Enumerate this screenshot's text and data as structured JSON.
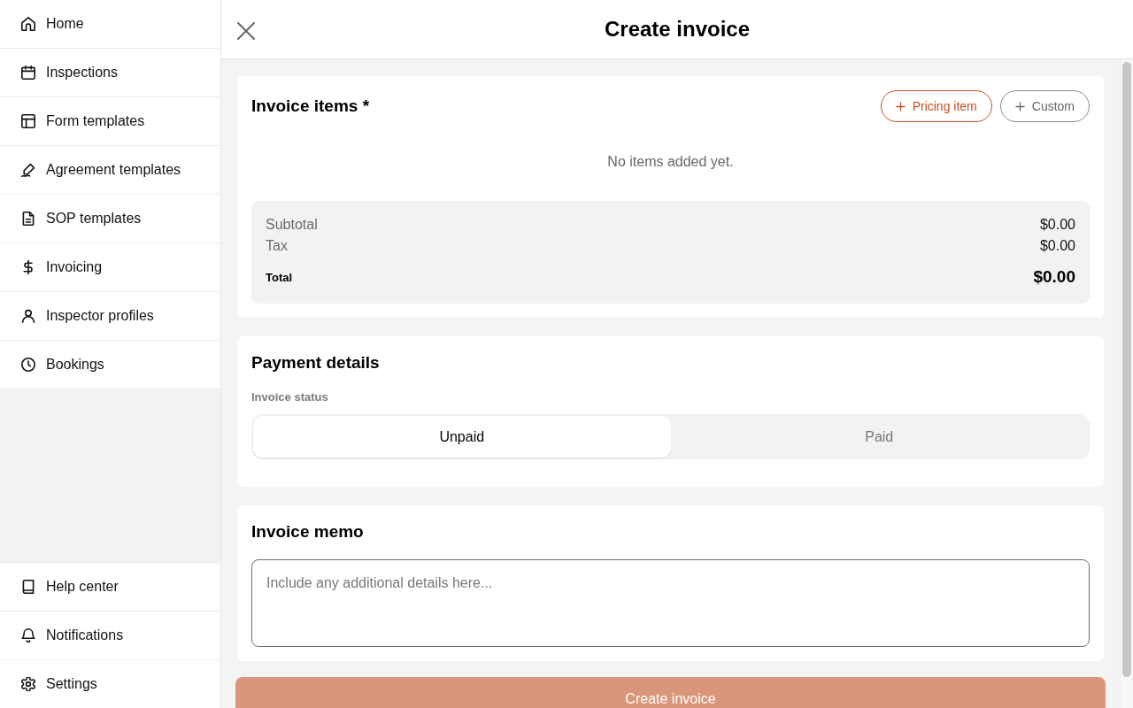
{
  "sidebar": {
    "items": [
      {
        "label": "Home"
      },
      {
        "label": "Inspections"
      },
      {
        "label": "Form templates"
      },
      {
        "label": "Agreement templates"
      },
      {
        "label": "SOP templates"
      },
      {
        "label": "Invoicing"
      },
      {
        "label": "Inspector profiles"
      },
      {
        "label": "Bookings"
      }
    ],
    "bottom_items": [
      {
        "label": "Help center"
      },
      {
        "label": "Notifications"
      },
      {
        "label": "Settings"
      }
    ]
  },
  "header": {
    "title": "Create invoice"
  },
  "invoice_items": {
    "title": "Invoice items *",
    "buttons": [
      {
        "label": "Pricing item",
        "kind": "primary"
      },
      {
        "label": "Custom",
        "kind": "secondary"
      }
    ],
    "empty_message": "No items added yet.",
    "totals": [
      {
        "label": "Subtotal",
        "value": "$0.00",
        "kind": "line"
      },
      {
        "label": "Tax",
        "value": "$0.00",
        "kind": "line"
      },
      {
        "label": "Total",
        "value": "$0.00",
        "kind": "total"
      }
    ]
  },
  "payment_details": {
    "title": "Payment details",
    "status_label": "Invoice status",
    "status_options": [
      {
        "label": "Unpaid",
        "selected": true
      },
      {
        "label": "Paid",
        "selected": false
      }
    ]
  },
  "memo": {
    "title": "Invoice memo",
    "placeholder": "Include any additional details here..."
  },
  "submit_button": {
    "label": "Create invoice",
    "disabled": true
  }
}
